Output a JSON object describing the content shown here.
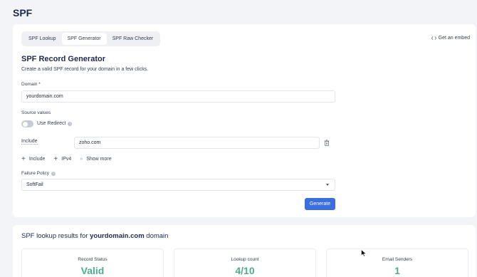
{
  "page": {
    "title": "SPF"
  },
  "tabs": [
    {
      "label": "SPF Lookup",
      "active": false
    },
    {
      "label": "SPF Generator",
      "active": true
    },
    {
      "label": "SPF Raw Checker",
      "active": false
    }
  ],
  "embed": {
    "label": "Get an embed",
    "icon": "code-icon"
  },
  "generator": {
    "title": "SPF Record Generator",
    "description": "Create a valid SPF record for your domain in a few clicks.",
    "domain_label": "Domain *",
    "domain_value": "yourdomain.com",
    "source_values_label": "Source values",
    "use_redirect_label": "Use Redirect",
    "use_redirect_on": false,
    "include_label": "Include",
    "include_value": "zoho.com",
    "add_include_label": "Include",
    "add_ipv4_label": "IPv4",
    "show_more_label": "Show more",
    "failure_policy_label": "Failure Policy",
    "failure_policy_value": "SoftFail",
    "generate_label": "Generate"
  },
  "results": {
    "title_prefix": "SPF lookup results for ",
    "domain": "yourdomain.com",
    "title_suffix": " domain",
    "stats": [
      {
        "label": "Record Status",
        "value": "Valid"
      },
      {
        "label": "Lookup count",
        "value": "4/10"
      },
      {
        "label": "Email Senders",
        "value": "1"
      }
    ]
  },
  "colors": {
    "primary": "#3b6fe0",
    "success": "#4caf8b",
    "heading": "#1e2a4a"
  }
}
